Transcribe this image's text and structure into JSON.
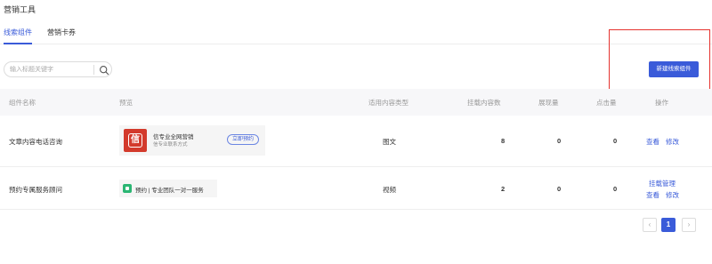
{
  "page": {
    "title": "营销工具"
  },
  "tabs": [
    {
      "label": "线索组件",
      "active": true
    },
    {
      "label": "营销卡券",
      "active": false
    }
  ],
  "search": {
    "placeholder": "输入标题关键字",
    "icon": "search-icon"
  },
  "toolbar": {
    "new_button_label": "新建线索组件"
  },
  "table": {
    "headers": {
      "name": "组件名称",
      "preview": "预览",
      "content_type": "适用内容类型",
      "mount_count": "挂载内容数",
      "impressions": "展现量",
      "clicks": "点击量",
      "actions": "操作"
    },
    "rows": [
      {
        "name": "文章内容电话咨询",
        "preview": {
          "icon": "brand-logo-icon",
          "icon_glyph": "信",
          "title": "信专业全网营销",
          "subtitle": "信专业联系方式",
          "button": "立即预约"
        },
        "content_type": "图文",
        "mount_count": "8",
        "impressions": "0",
        "clicks": "0",
        "actions": [
          "查看",
          "修改"
        ]
      },
      {
        "name": "预约专属服务顾问",
        "preview": {
          "icon": "green-square-icon",
          "text": "预约 | 专业团队一对一服务"
        },
        "content_type": "视频",
        "mount_count": "2",
        "impressions": "0",
        "clicks": "0",
        "actions": [
          "挂载管理",
          "查看",
          "修改"
        ]
      }
    ]
  },
  "pagination": {
    "prev": "‹",
    "current": "1",
    "next": "›"
  },
  "colors": {
    "accent": "#3a5bd9",
    "highlight": "#e5332f",
    "brand_red": "#d33a2c",
    "green": "#2bb673"
  }
}
